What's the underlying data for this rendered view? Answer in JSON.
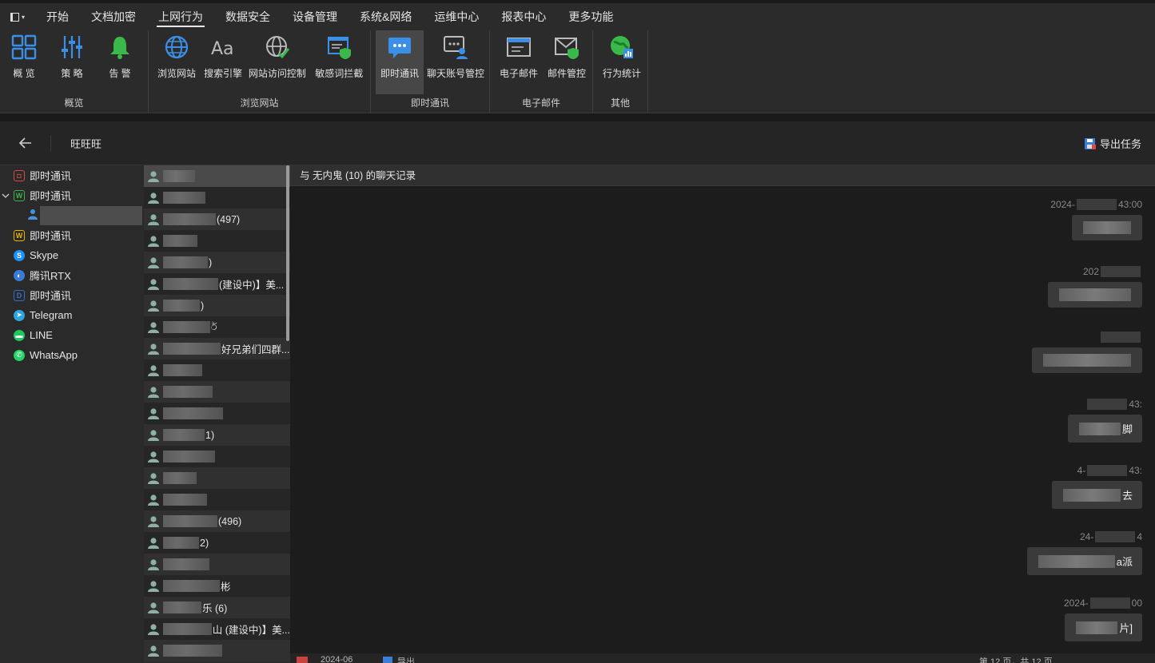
{
  "menu": {
    "items": [
      "开始",
      "文档加密",
      "上网行为",
      "数据安全",
      "设备管理",
      "系统&网络",
      "运维中心",
      "报表中心",
      "更多功能"
    ],
    "active_index": 2
  },
  "ribbon": {
    "groups": [
      {
        "name": "概览",
        "buttons": [
          {
            "label": "概 览",
            "icon": "dashboard-icon"
          },
          {
            "label": "策 略",
            "icon": "policy-sliders-icon"
          },
          {
            "label": "告 警",
            "icon": "alert-bell-icon"
          }
        ]
      },
      {
        "name": "浏览网站",
        "buttons": [
          {
            "label": "浏览网站",
            "icon": "globe-icon"
          },
          {
            "label": "搜索引擎",
            "icon": "search-engine-aa-icon"
          },
          {
            "label": "网站访问控制",
            "icon": "globe-check-icon"
          },
          {
            "label": "敏感词拦截",
            "icon": "sensitive-word-shield-icon"
          }
        ]
      },
      {
        "name": "即时通讯",
        "buttons": [
          {
            "label": "即时通讯",
            "icon": "chat-bubble-icon",
            "active": true
          },
          {
            "label": "聊天账号管控",
            "icon": "chat-account-icon"
          }
        ]
      },
      {
        "name": "电子邮件",
        "buttons": [
          {
            "label": "电子邮件",
            "icon": "email-icon"
          },
          {
            "label": "邮件管控",
            "icon": "email-shield-icon"
          }
        ]
      },
      {
        "name": "其他",
        "buttons": [
          {
            "label": "行为统计",
            "icon": "behavior-stats-icon"
          }
        ]
      }
    ]
  },
  "toolbar": {
    "breadcrumb": "旺旺旺",
    "export_task": "导出任务"
  },
  "sidebar": {
    "items": [
      {
        "label": "即时通讯",
        "icon": "im-red-icon",
        "color": "#d94a4a"
      },
      {
        "label": "即时通讯",
        "icon": "im-green-w-icon",
        "color": "#3cb44b",
        "expanded": true
      },
      {
        "label": "",
        "icon": "user-icon",
        "child": true,
        "selected": true
      },
      {
        "label": "即时通讯",
        "icon": "im-yellow-w-icon",
        "color": "#e8b400"
      },
      {
        "label": "Skype",
        "icon": "skype-icon",
        "color": "#1e90ff"
      },
      {
        "label": "腾讯RTX",
        "icon": "rtx-icon",
        "color": "#3a7bd5"
      },
      {
        "label": "即时通讯",
        "icon": "im-blue-d-icon",
        "color": "#2f6fd0"
      },
      {
        "label": "Telegram",
        "icon": "telegram-icon",
        "color": "#2ca5e0"
      },
      {
        "label": "LINE",
        "icon": "line-icon",
        "color": "#22c55e"
      },
      {
        "label": "WhatsApp",
        "icon": "whatsapp-icon",
        "color": "#25d366"
      }
    ]
  },
  "contacts": [
    {
      "suffix": ""
    },
    {
      "suffix": ""
    },
    {
      "suffix": "(497)"
    },
    {
      "suffix": ""
    },
    {
      "suffix": ")"
    },
    {
      "suffix": "(建设中)】美..."
    },
    {
      "suffix": ")"
    },
    {
      "suffix": "ර්"
    },
    {
      "suffix": "好兄弟们四群..."
    },
    {
      "suffix": ""
    },
    {
      "suffix": ""
    },
    {
      "suffix": ""
    },
    {
      "suffix": "1)"
    },
    {
      "suffix": ""
    },
    {
      "suffix": ""
    },
    {
      "suffix": ""
    },
    {
      "suffix": "(496)"
    },
    {
      "suffix": "2)"
    },
    {
      "suffix": ""
    },
    {
      "suffix": "彬"
    },
    {
      "suffix": "乐 (6)"
    },
    {
      "suffix": "山 (建设中)】美..."
    },
    {
      "suffix": ""
    }
  ],
  "chat": {
    "header": "与 无内鬼 (10) 的聊天记录",
    "messages": [
      {
        "time_prefix": "2024-",
        "time_suffix": "43:00",
        "text_suffix": ""
      },
      {
        "time_prefix": "202",
        "time_suffix": "",
        "text_suffix": ""
      },
      {
        "time_prefix": "",
        "time_suffix": "",
        "text_suffix": ""
      },
      {
        "time_prefix": "",
        "time_suffix": "43:",
        "text_suffix": "脚"
      },
      {
        "time_prefix": "4-",
        "time_suffix": "43:",
        "text_suffix": "去"
      },
      {
        "time_prefix": "24-",
        "time_suffix": "4",
        "text_suffix": "a派"
      },
      {
        "time_prefix": "2024-",
        "time_suffix": "00",
        "text_suffix": "片]"
      }
    ]
  },
  "pager": {
    "date": "2024-06",
    "export": "导出",
    "page_info": "第 12 页，共 12 页"
  }
}
